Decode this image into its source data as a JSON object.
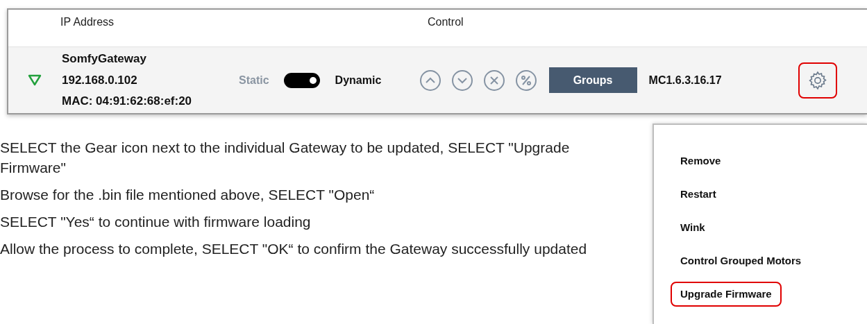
{
  "gateway_table": {
    "columns": [
      "IP Address",
      "Control"
    ],
    "row": {
      "name": "SomfyGateway",
      "ip": "192.168.0.102",
      "mac": "MAC: 04:91:62:68:ef:20",
      "mode_left": "Static",
      "mode_right": "Dynamic",
      "mode_toggle": {
        "on": true
      },
      "groups_button": "Groups",
      "version": "MC1.6.3.16.17",
      "gear_highlighted": true
    }
  },
  "steps": [
    "SELECT the Gear icon next to the individual Gateway to be updated, SELECT \"Upgrade Firmware\"",
    "Browse for the .bin file mentioned above, SELECT \"Open“",
    "SELECT \"Yes“ to continue with firmware loading",
    "Allow the process to complete, SELECT \"OK“ to confirm the Gateway successfully updated"
  ],
  "menu": {
    "items": [
      {
        "label": "Remove",
        "highlighted": false
      },
      {
        "label": "Restart",
        "highlighted": false
      },
      {
        "label": "Wink",
        "highlighted": false
      },
      {
        "label": "Control Grouped Motors",
        "highlighted": false
      },
      {
        "label": "Upgrade Firmware",
        "highlighted": true
      }
    ]
  }
}
